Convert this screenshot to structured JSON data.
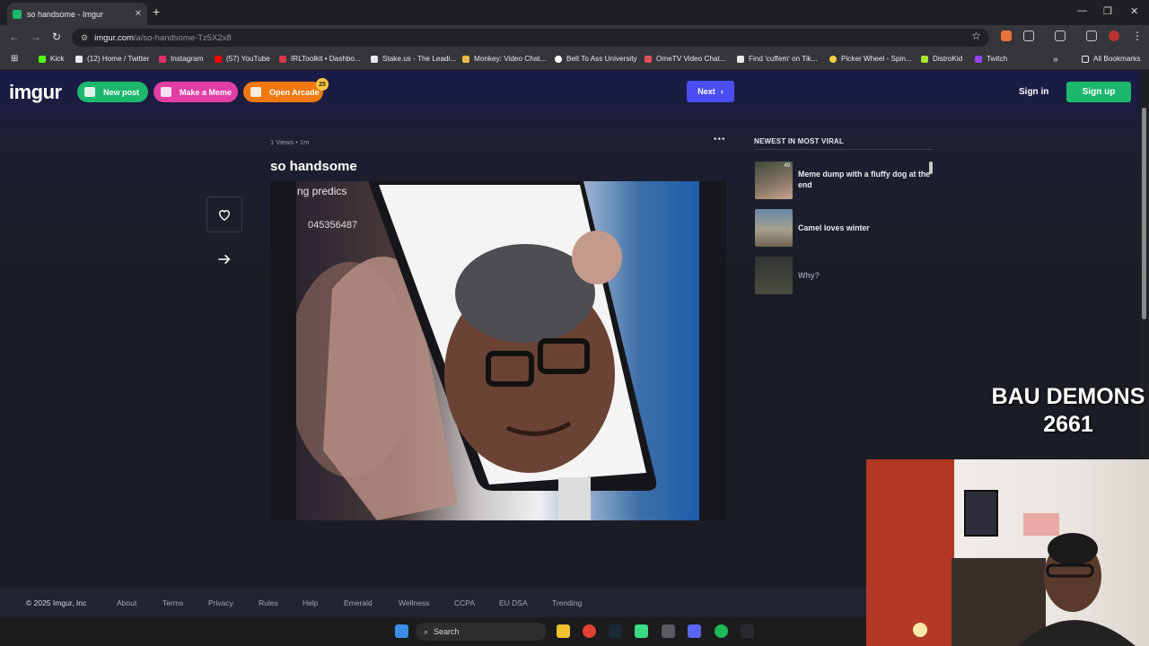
{
  "browser": {
    "tab_title": "so handsome - Imgur",
    "url_host": "imgur.com",
    "url_path": "/a/so-handsome-Tz5X2x8",
    "bookmarks": [
      {
        "label": "Kick",
        "color": "#53fc18"
      },
      {
        "label": "(12) Home / Twitter",
        "color": "#e7e9ea"
      },
      {
        "label": "Instagram",
        "color": "#e1306c"
      },
      {
        "label": "(57) YouTube",
        "color": "#ff0000"
      },
      {
        "label": "IRLToolkit • Dashbo...",
        "color": "#d9364b"
      },
      {
        "label": "Stake.us - The Leadi...",
        "color": "#e8e8e8"
      },
      {
        "label": "Monkey: Video Chat...",
        "color": "#f2b84b"
      },
      {
        "label": "Belt To Ass University",
        "color": "#ffffff"
      },
      {
        "label": "OmeTV Video Chat...",
        "color": "#e0505a"
      },
      {
        "label": "Find 'cuffem' on Tik...",
        "color": "#e8e8e8"
      },
      {
        "label": "Picker Wheel - Spin...",
        "color": "#f4d03f"
      },
      {
        "label": "DistroKid",
        "color": "#a6e22e"
      },
      {
        "label": "Twitch",
        "color": "#9146ff"
      }
    ],
    "more_bookmarks": "»",
    "all_bookmarks": "All Bookmarks"
  },
  "header": {
    "logo": "imgur",
    "new_post": "New post",
    "make_meme": "Make a Meme",
    "open_arcade": "Open Arcade",
    "arcade_badge": "25",
    "next": "Next",
    "sign_in": "Sign in",
    "sign_up": "Sign up"
  },
  "post": {
    "meta": "1 Views • 1m",
    "more": "•••",
    "title": "so handsome",
    "image_caption": "ng predics",
    "image_number": "045356487"
  },
  "sidebar": {
    "heading": "NEWEST IN MOST VIRAL",
    "items": [
      {
        "title": "Meme dump with a fluffy dog at the end",
        "badge": "49"
      },
      {
        "title": "Camel loves winter"
      },
      {
        "title": "Why?"
      }
    ]
  },
  "stream_overlay": {
    "line1": "BAU DEMONS",
    "line2": "2661"
  },
  "footer": {
    "copyright": "© 2025 Imgur, Inc",
    "links": [
      "About",
      "Terms",
      "Privacy",
      "Rules",
      "Help",
      "Emerald",
      "Wellness",
      "CCPA",
      "EU DSA",
      "Trending"
    ]
  },
  "taskbar": {
    "search_label": "Search"
  },
  "colors": {
    "imgur_green": "#1bb76e",
    "meme_pink": "#e23fa6",
    "arcade_orange": "#f0780e",
    "next_blue": "#4a4ef2"
  }
}
